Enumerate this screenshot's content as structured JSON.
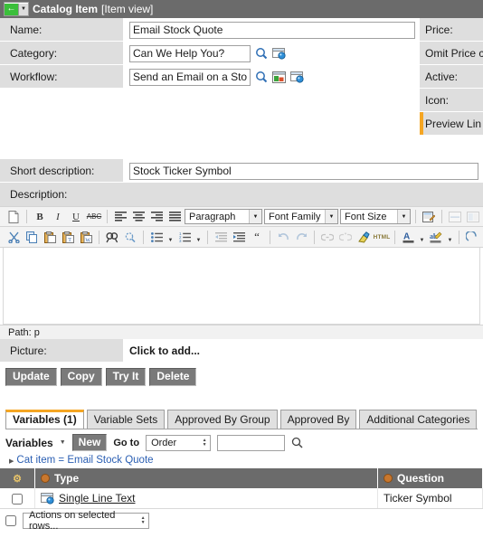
{
  "titlebar": {
    "back_icon": "green-back-arrow-icon",
    "caret_icon": "chevron-down-icon",
    "title": "Catalog Item",
    "subtitle": "[Item view]"
  },
  "form": {
    "rows": [
      {
        "label": "Name:",
        "value": "Email Stock Quote",
        "right": "Price:"
      },
      {
        "label": "Category:",
        "value": "Can We Help You?",
        "right": "Omit Price c"
      },
      {
        "label": "Workflow:",
        "value": "Send an Email on a Sto",
        "right": "Active:"
      }
    ],
    "right_extra": [
      {
        "label": "Icon:",
        "mandatory": false
      },
      {
        "label": "Preview Lin",
        "mandatory": true
      }
    ],
    "short_description": {
      "label": "Short description:",
      "value": "Stock Ticker Symbol"
    },
    "description": {
      "label": "Description:"
    },
    "picture": {
      "label": "Picture:",
      "value": "Click to add..."
    }
  },
  "editor": {
    "row1": {
      "new_doc": "new-document-icon",
      "bold": "B",
      "italic": "I",
      "underline": "U",
      "strike": "ABC",
      "align_left": "align-left-icon",
      "align_center": "align-center-icon",
      "align_right": "align-right-icon",
      "align_justify": "align-justify-icon",
      "paragraph": "Paragraph",
      "font_family": "Font Family",
      "font_size": "Font Size",
      "edit_source": "edit-template-icon",
      "insert_hr": "horizontal-rule-icon",
      "insert_image": "insert-image-icon"
    },
    "row2": {
      "cut": "scissors-icon",
      "copy": "copy-icon",
      "paste": "paste-icon",
      "paste_text": "paste-as-text-icon",
      "paste_word": "paste-from-word-icon",
      "find": "find-icon",
      "replace": "find-replace-icon",
      "bullet_list": "bulleted-list-icon",
      "number_list": "numbered-list-icon",
      "outdent": "outdent-icon",
      "indent": "indent-icon",
      "blockquote": "blockquote-icon",
      "undo": "undo-icon",
      "redo": "redo-icon",
      "link": "link-icon",
      "unlink": "unlink-icon",
      "clear_format": "clear-formatting-icon",
      "html": "HTML",
      "text_color": "A",
      "highlight": "highlight-icon",
      "eraser": "eraser-icon"
    },
    "path_label": "Path: p"
  },
  "buttons": [
    {
      "label": "Update"
    },
    {
      "label": "Copy"
    },
    {
      "label": "Try It"
    },
    {
      "label": "Delete"
    }
  ],
  "tabs": [
    {
      "label": "Variables (1)",
      "active": true
    },
    {
      "label": "Variable Sets",
      "active": false
    },
    {
      "label": "Approved By Group",
      "active": false
    },
    {
      "label": "Approved By",
      "active": false
    },
    {
      "label": "Additional Categories",
      "active": false
    }
  ],
  "list": {
    "title": "Variables",
    "title_caret": "chevron-down-icon",
    "new_button": "New",
    "goto_label": "Go to",
    "goto_field": "Order",
    "search_value": "",
    "search_icon": "magnifier-icon",
    "breadcrumb": "Cat item = Email Stock Quote",
    "columns": [
      {
        "key": "check",
        "label": ""
      },
      {
        "key": "type",
        "label": "Type"
      },
      {
        "key": "question",
        "label": "Question"
      }
    ],
    "rows": [
      {
        "type": "Single Line Text",
        "question": "Ticker Symbol",
        "type_icon": "reference-record-icon"
      }
    ],
    "footer_action": "Actions on selected rows..."
  },
  "colors": {
    "header_gray": "#6b6b6b",
    "label_gray": "#dedede",
    "accent_orange": "#f5a623",
    "link_blue": "#2b5fb3",
    "button_gray": "#7a7a7a"
  }
}
